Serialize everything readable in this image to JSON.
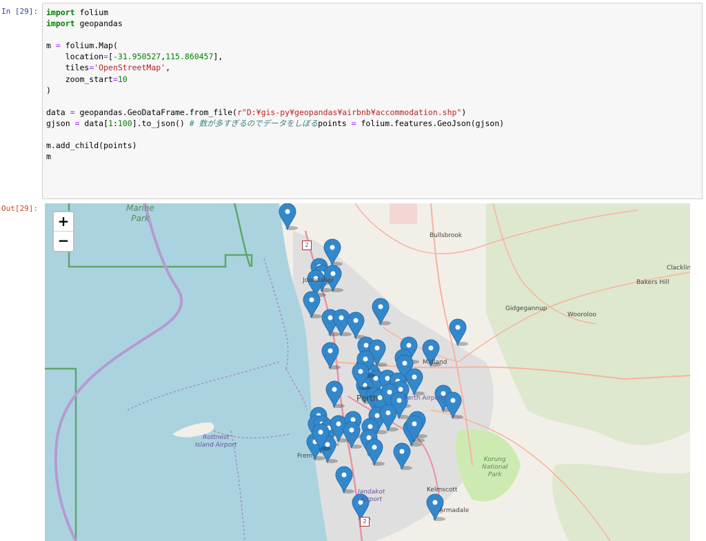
{
  "input_prompt": "In [29]:",
  "output_prompt": "Out[29]:",
  "code": {
    "l1": {
      "kw": "import",
      "rest": " folium"
    },
    "l2": {
      "kw": "import",
      "rest": " geopandas"
    },
    "l3": {
      "a": "m ",
      "op": "=",
      "b": " folium.Map("
    },
    "l4": {
      "a": "    location",
      "op": "=",
      "b": "[",
      "n1": "-31.950527",
      "c": ",",
      "n2": "115.860457",
      "d": "],"
    },
    "l5": {
      "a": "    tiles",
      "op": "=",
      "s": "'OpenStreetMap'",
      "d": ","
    },
    "l6": {
      "a": "    zoom_start",
      "op": "=",
      "n": "10"
    },
    "l7": ")",
    "l8": {
      "a": "data ",
      "op": "=",
      "b": " geopandas.GeoDataFrame.from_file(",
      "s": "r\"D:¥gis-py¥geopandas¥airbnb¥accommodation.shp\"",
      "d": ")"
    },
    "l9": {
      "a": "gjson ",
      "op": "=",
      "b": " data[",
      "n1": "1",
      "c": ":",
      "n2": "100",
      "d": "].to_json() ",
      "cm": "# 数が多すぎるのでデータをしぼる"
    },
    "l10": {
      "a": "points ",
      "op": "=",
      "b": " folium.features.GeoJson(gjson)"
    },
    "l11": "m.add_child(points)",
    "l12": "m"
  },
  "map": {
    "zoom_in": "+",
    "zoom_out": "−",
    "places": {
      "marine_park": "Marine\nPark",
      "bullsbrook": "Bullsbrook",
      "clacklin": "Clacklin",
      "bakers_hill": "Bakers Hill",
      "gidgegannup": "Gidgegannup",
      "wooroloo": "Wooroloo",
      "midland": "Midland",
      "perth_airport": "Perth Airport",
      "perth": "Perth",
      "rottnest_airport": "Rottnest\nIsland Airport",
      "fremantle": "Frem",
      "korung": "Korung\nNational\nPark",
      "jandakot_airport": "Jandakot\nAirport",
      "kelmscott": "Kelmscott",
      "armadale": "Armadale",
      "joondalup": "Joondalup",
      "route_2a": "2",
      "route_2b": "2"
    },
    "colors": {
      "marker": "#3388cc",
      "water": "#aad3df",
      "land": "#f2efe9",
      "park": "#cdebb0",
      "urban": "#e0dfdf",
      "road": "#e892a2"
    }
  }
}
